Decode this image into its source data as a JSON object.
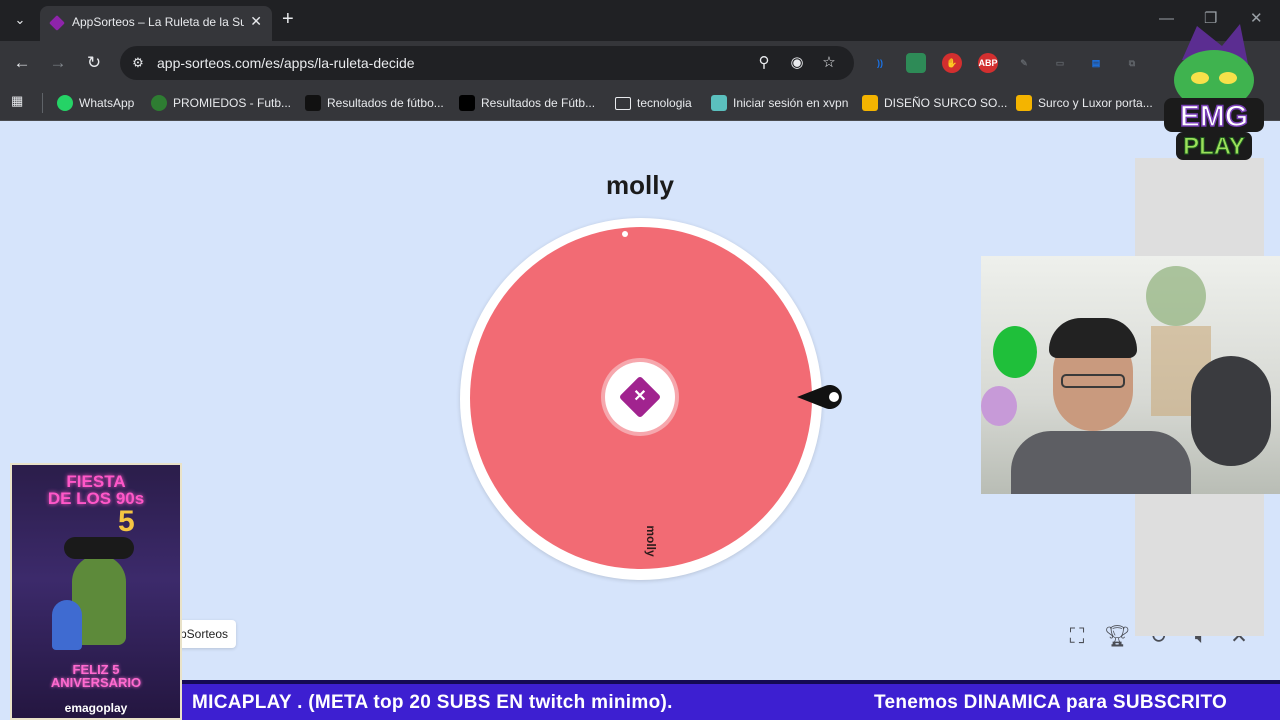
{
  "browser": {
    "tab_title": "AppSorteos – La Ruleta de la Su",
    "tab_close": "✕",
    "new_tab": "+",
    "url": "app-sorteos.com/es/apps/la-ruleta-decide",
    "bookmarks": [
      {
        "label": "WhatsApp",
        "color": "#25d366"
      },
      {
        "label": "PROMIEDOS - Futb...",
        "color": "#2e7d32"
      },
      {
        "label": "Resultados de fútbo...",
        "color": "#111111"
      },
      {
        "label": "Resultados de Fútb...",
        "color": "#000000"
      },
      {
        "label": "tecnologia",
        "color": "folder"
      },
      {
        "label": "Iniciar sesión en xvpn",
        "color": "#5bc0be"
      },
      {
        "label": "DISEÑO SURCO SO...",
        "color": "#f4b400"
      },
      {
        "label": "Surco y Luxor porta...",
        "color": "#f4b400"
      }
    ],
    "extensions": [
      {
        "name": "wifi-ext",
        "text": "))",
        "color": "#1a73e8"
      },
      {
        "name": "flag-ext",
        "text": "",
        "color": "#2e8b57"
      },
      {
        "name": "stop-ext",
        "text": "✋",
        "color": "#d32f2f"
      },
      {
        "name": "abp-ext",
        "text": "ABP",
        "color": "#d32f2f"
      },
      {
        "name": "feather-ext",
        "text": "✎",
        "color": "#5f6368"
      },
      {
        "name": "cast-ext",
        "text": "▭",
        "color": "#5f6368"
      },
      {
        "name": "screen-ext",
        "text": "▤",
        "color": "#1a73e8"
      },
      {
        "name": "puzzle-ext",
        "text": "⧉",
        "color": "#5f6368"
      }
    ]
  },
  "wheel": {
    "winner": "molly",
    "segments": [
      {
        "label": "molly",
        "color": "#f26b74"
      }
    ]
  },
  "brand_tag": "pSorteos",
  "controls": [
    "fullscreen-icon",
    "trophy-icon",
    "reset-icon",
    "volume-icon",
    "close-icon"
  ],
  "overlay": {
    "logo_line1": "EMG",
    "logo_line2": "PLAY",
    "poster": {
      "title": "FIESTA\nDE LOS 90s",
      "bottom": "FELIZ 5\nANIVERSARIO",
      "brand": "emagoplay",
      "number": "5"
    },
    "ticker_1": "MICAPLAY .  (META  top 20 SUBS  EN  twitch minimo).",
    "ticker_2": "Tenemos DINAMICA para SUBSCRITO"
  }
}
